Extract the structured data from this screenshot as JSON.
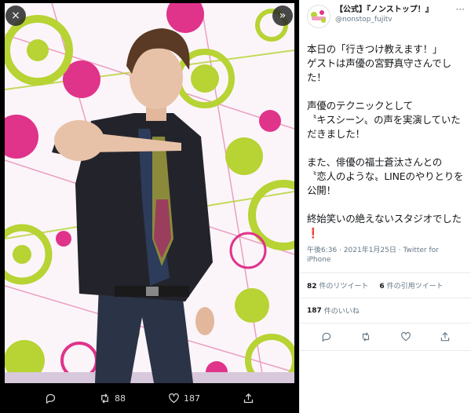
{
  "viewer": {
    "close_icon": "×",
    "next_icon": "»",
    "retweet_count": "88",
    "like_count": "187"
  },
  "tweet": {
    "display_name": "【公式】『ノンストップ！』",
    "handle": "@nonstop_fujitv",
    "text_main": "本日の「行きつけ教えます！」\nゲストは声優の宮野真守さんでした！\n\n声優のテクニックとして\n〝キスシーン〟の声を実演していただきました！\n\nまた、俳優の福士蒼汰さんとの\n〝恋人のような〟LINEのやりとりを公開！\n\n終始笑いの絶えないスタジオでした",
    "text_mark": "❗",
    "timestamp": "午後6:36 · 2021年1月25日 · ",
    "source": "Twitter for iPhone",
    "retweets_num": "82",
    "retweets_label": "件のリツイート",
    "quotes_num": "6",
    "quotes_label": "件の引用ツイート",
    "likes_num": "187",
    "likes_label": "件のいいね"
  },
  "colors": {
    "accent_pink": "#e0245e",
    "dot_magenta": "#e0338a",
    "dot_lime": "#b7d334"
  }
}
